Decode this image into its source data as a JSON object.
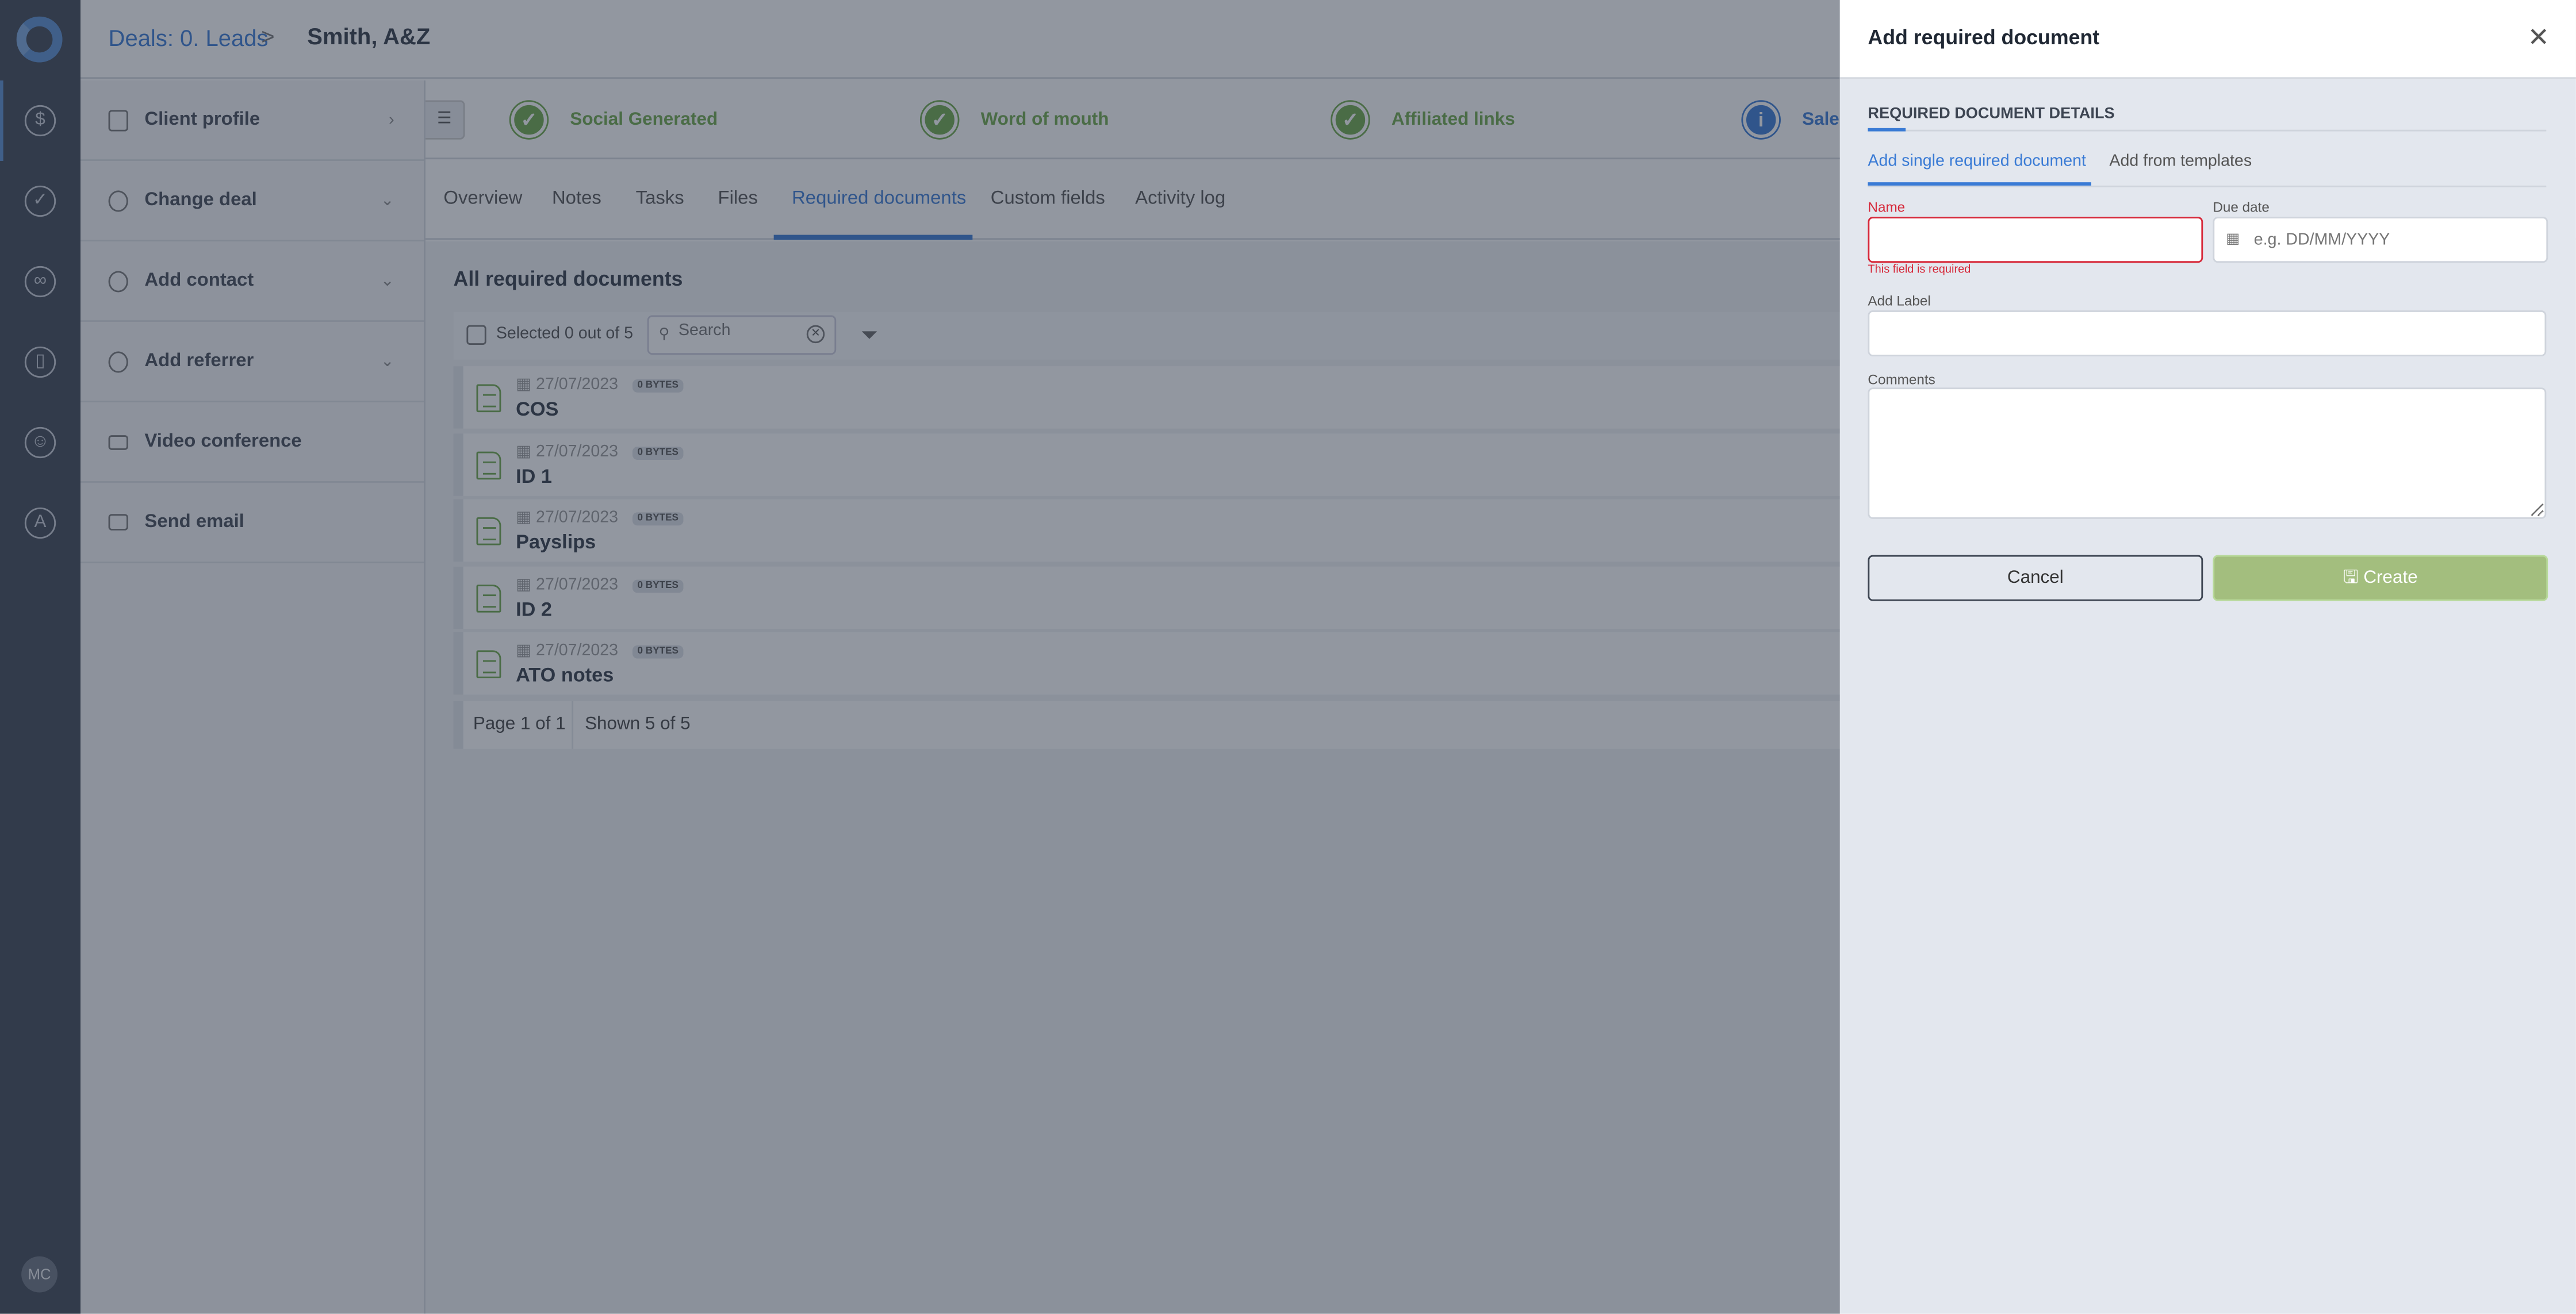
{
  "header": {
    "breadcrumb": "Deals: 0. Leads",
    "breadcrumb_sep": ">",
    "title": "Smith, A&Z"
  },
  "rail": {
    "avatar": "MC",
    "icons": [
      "dollar-icon",
      "check-icon",
      "contacts-icon",
      "map-icon",
      "user-icon",
      "a-icon"
    ]
  },
  "sidepanel": {
    "items": [
      {
        "label": "Client profile",
        "chevron": "›"
      },
      {
        "label": "Change deal",
        "chevron": "⌄"
      },
      {
        "label": "Add contact",
        "chevron": "⌄"
      },
      {
        "label": "Add referrer",
        "chevron": "⌄"
      },
      {
        "label": "Video conference",
        "chevron": ""
      },
      {
        "label": "Send email",
        "chevron": ""
      }
    ]
  },
  "stages": [
    {
      "label": "Social Generated",
      "status": "done",
      "glyph": "✓"
    },
    {
      "label": "Word of mouth",
      "status": "done",
      "glyph": "✓"
    },
    {
      "label": "Affiliated links",
      "status": "done",
      "glyph": "✓"
    },
    {
      "label": "Sale",
      "status": "info",
      "glyph": "i"
    }
  ],
  "tabs": [
    "Overview",
    "Notes",
    "Tasks",
    "Files",
    "Required documents",
    "Custom fields",
    "Activity log"
  ],
  "active_tab": "Required documents",
  "documents": {
    "heading": "All required documents",
    "selected": "Selected 0 out of 5",
    "search_placeholder": "Search",
    "rows": [
      {
        "date": "27/07/2023",
        "size": "0 BYTES",
        "name": "COS"
      },
      {
        "date": "27/07/2023",
        "size": "0 BYTES",
        "name": "ID 1"
      },
      {
        "date": "27/07/2023",
        "size": "0 BYTES",
        "name": "Payslips"
      },
      {
        "date": "27/07/2023",
        "size": "0 BYTES",
        "name": "ID 2"
      },
      {
        "date": "27/07/2023",
        "size": "0 BYTES",
        "name": "ATO notes"
      }
    ],
    "pager": {
      "page": "Page 1 of 1",
      "shown": "Shown 5 of 5"
    }
  },
  "panel": {
    "title": "Add required document",
    "section": "REQUIRED DOCUMENT DETAILS",
    "tabs": [
      "Add single required document",
      "Add from templates"
    ],
    "name_label": "Name",
    "name_value": "",
    "name_error": "This field is required",
    "due_label": "Due date",
    "due_placeholder": "e.g. DD/MM/YYYY",
    "label_label": "Add Label",
    "label_value": "",
    "comments_label": "Comments",
    "comments_value": "",
    "cancel": "Cancel",
    "create": "Create"
  },
  "colors": {
    "accent": "#3a7bd5",
    "success": "#6ea84a",
    "error": "#d62839",
    "create_button": "#a3be7e"
  }
}
